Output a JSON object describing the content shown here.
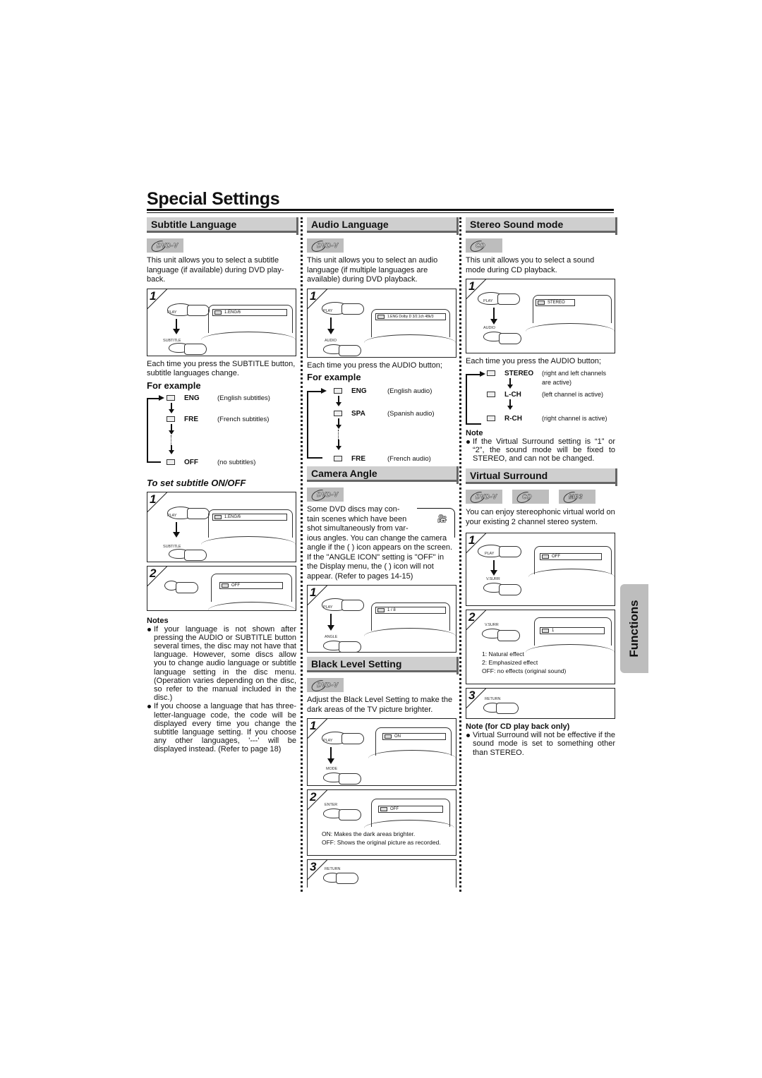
{
  "page": {
    "title": "Special Settings",
    "side_tab": "Functions"
  },
  "subtitle": {
    "heading": "Subtitle Language",
    "disc_badges": [
      "DVD-V"
    ],
    "intro": "This unit allows you to select a subtitle language (if available) during DVD play-back.",
    "step1": {
      "number": "1",
      "play_label": "PLAY",
      "button_label": "SUBTITLE",
      "osd": "1.ENG/6"
    },
    "press_text": "Each time you press the SUBTITLE button, subtitle languages change.",
    "example_title": "For example",
    "examples": [
      {
        "code": "ENG",
        "desc": "(English subtitles)"
      },
      {
        "code": "FRE",
        "desc": "(French subtitles)"
      },
      {
        "code": "OFF",
        "desc": "(no subtitles)"
      }
    ],
    "onoff_title": "To set subtitle ON/OFF",
    "onoff_step1": {
      "number": "1",
      "play_label": "PLAY",
      "button_label": "SUBTITLE",
      "osd": "1.ENG/6"
    },
    "onoff_step2": {
      "number": "2",
      "osd": "OFF"
    },
    "notes_title": "Notes",
    "notes": [
      "If your language is not shown after pressing the AUDIO or SUBTITLE button several times, the disc may not have that language. However, some discs allow you to change audio language or subtitle language setting in the disc menu. (Operation varies depending on the disc, so refer to the manual included in the disc.)",
      "If you choose a language that has three-letter-language code, the code will be displayed every time you change the subtitle language setting. If you choose any other languages, '---' will be displayed instead. (Refer to page 18)"
    ]
  },
  "audio": {
    "heading": "Audio Language",
    "disc_badges": [
      "DVD-V"
    ],
    "intro": "This unit allows you to select an audio language (if multiple languages are available) during DVD playback.",
    "step1": {
      "number": "1",
      "play_label": "PLAY",
      "button_label": "AUDIO",
      "osd": "1.ENG Dolby D 3/2.1ch 48k/3"
    },
    "press_text": "Each time you press the AUDIO button;",
    "example_title": "For example",
    "examples": [
      {
        "code": "ENG",
        "desc": "(English audio)"
      },
      {
        "code": "SPA",
        "desc": "(Spanish audio)"
      },
      {
        "code": "FRE",
        "desc": "(French audio)"
      }
    ]
  },
  "camera": {
    "heading": "Camera Angle",
    "disc_badges": [
      "DVD-V"
    ],
    "intro_lines": [
      "Some DVD discs may con-",
      "tain scenes which have been",
      "shot simultaneously from var-"
    ],
    "intro_rest": "ious angles. You can change the camera angle if the ( ) icon appears on the screen. If the \"ANGLE ICON\" setting is \"OFF\" in the Display menu, the ( ) icon will not appear. (Refer to pages 14-15)",
    "step1": {
      "number": "1",
      "play_label": "PLAY",
      "button_label": "ANGLE",
      "osd": "1 / 8"
    }
  },
  "black_level": {
    "heading": "Black Level Setting",
    "disc_badges": [
      "DVD-V"
    ],
    "intro": "Adjust the Black Level Setting to make the dark areas of the TV picture brighter.",
    "step1": {
      "number": "1",
      "play_label": "PLAY",
      "button_label": "MODE",
      "osd": "ON"
    },
    "step2": {
      "number": "2",
      "button_label": "ENTER",
      "osd": "OFF",
      "legend": [
        "ON: Makes the dark areas brighter.",
        "OFF: Shows the original picture as recorded."
      ]
    },
    "step3": {
      "number": "3",
      "button_label": "RETURN"
    }
  },
  "stereo": {
    "heading": "Stereo Sound mode",
    "disc_badges": [
      "CD"
    ],
    "intro": "This unit allows you to select a sound mode during CD playback.",
    "step1": {
      "number": "1",
      "play_label": "PLAY",
      "button_label": "AUDIO",
      "osd": "STEREO"
    },
    "press_text": "Each time you press the AUDIO button;",
    "examples": [
      {
        "code": "STEREO",
        "desc": "(right and left channels",
        "desc2": "are active)"
      },
      {
        "code": "L-CH",
        "desc": "(left channel is active)"
      },
      {
        "code": "R-CH",
        "desc": "(right channel is active)"
      }
    ],
    "note_title": "Note",
    "note": "If the Virtual Surround setting is “1” or “2”, the sound mode will be fixed to STEREO, and can not be changed."
  },
  "virtual": {
    "heading": "Virtual Surround",
    "disc_badges": [
      "DVD-V",
      "CD",
      "MP3"
    ],
    "intro": "You can enjoy stereophonic virtual world on your existing 2 channel stereo system.",
    "step1": {
      "number": "1",
      "play_label": "PLAY",
      "button_label": "V.SURR",
      "osd": "OFF"
    },
    "step2": {
      "number": "2",
      "button_label": "V.SURR",
      "osd": "1",
      "legend": [
        "1: Natural effect",
        "2: Emphasized effect",
        "OFF: no effects (original sound)"
      ]
    },
    "step3": {
      "number": "3",
      "button_label": "RETURN"
    },
    "note_title": "Note (for CD play back only)",
    "note": "Virtual Surround will not be effective if the sound mode is set to something other than STEREO."
  }
}
